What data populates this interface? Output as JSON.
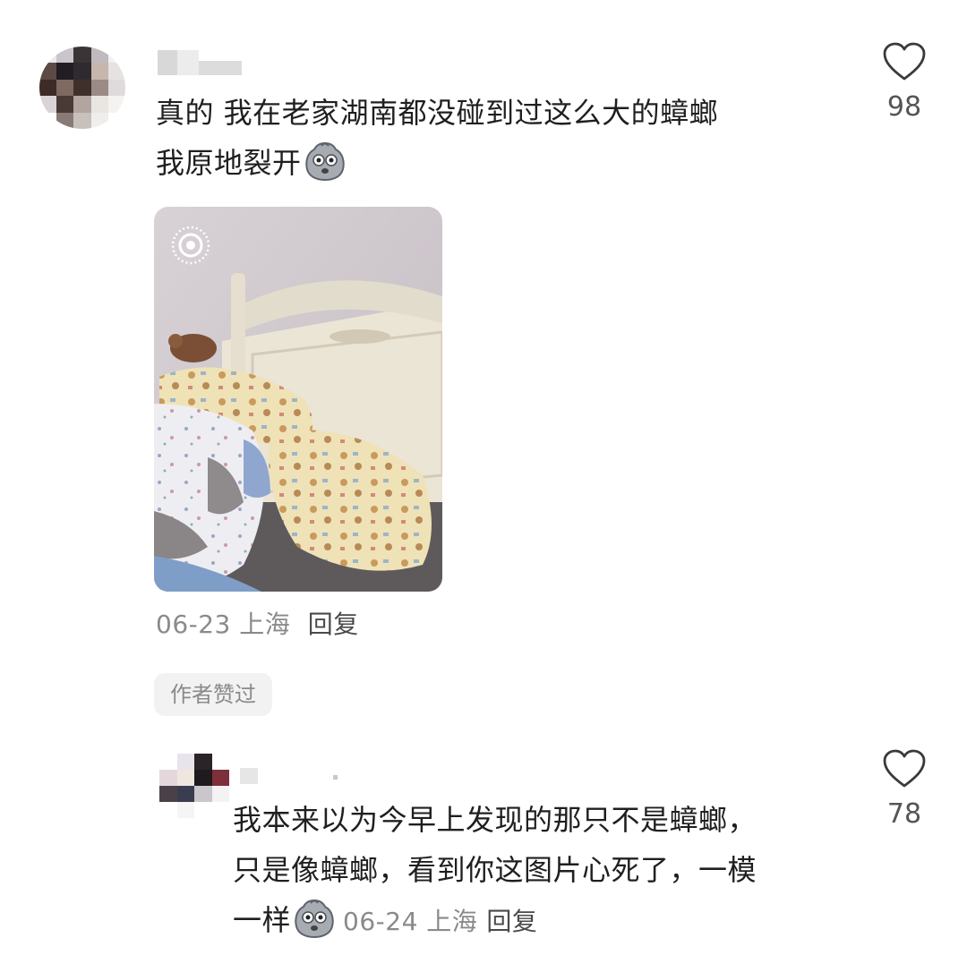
{
  "comment1": {
    "text_line1": "真的 我在老家湖南都没碰到过这么大的蟑螂",
    "text_line2": "我原地裂开",
    "date": "06-23",
    "location": "上海",
    "reply_label": "回复",
    "likes": "98",
    "author_liked_badge": "作者赞过"
  },
  "comment2": {
    "text_line1": "我本来以为今早上发现的那只不是蟑螂，",
    "text_line2": "只是像蟑螂，看到你这图片心死了，一模",
    "text_line3": "一样",
    "date": "06-24",
    "location": "上海",
    "reply_label": "回复",
    "likes": "78"
  },
  "icons": {
    "like": "heart-outline-icon",
    "emoji": "shocked-face-emoji",
    "live_photo": "live-photo-icon"
  },
  "colors": {
    "text": "#1f1f1f",
    "meta": "#8a8a8a",
    "badge_bg": "#f2f2f2"
  }
}
